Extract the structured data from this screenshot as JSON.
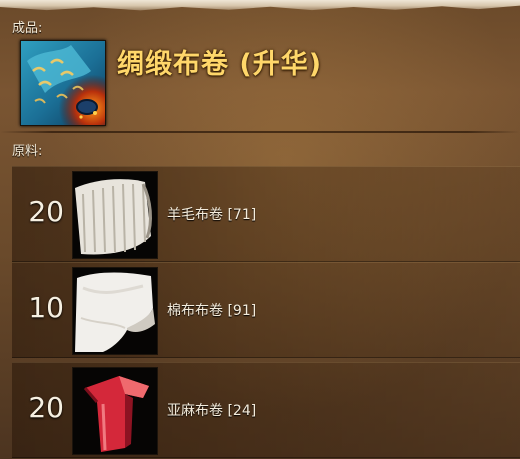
{
  "result": {
    "section_label": "成品:",
    "name": "绸缎布卷 (升华)",
    "icon": "silk-bolt-icon"
  },
  "materials": {
    "section_label": "原料:",
    "items": [
      {
        "quantity": "20",
        "name": "羊毛布卷 [71]",
        "icon": "wool-bolt-icon"
      },
      {
        "quantity": "10",
        "name": "棉布布卷 [91]",
        "icon": "cotton-bolt-icon"
      },
      {
        "quantity": "20",
        "name": "亚麻布卷 [24]",
        "icon": "linen-bolt-icon"
      }
    ]
  }
}
